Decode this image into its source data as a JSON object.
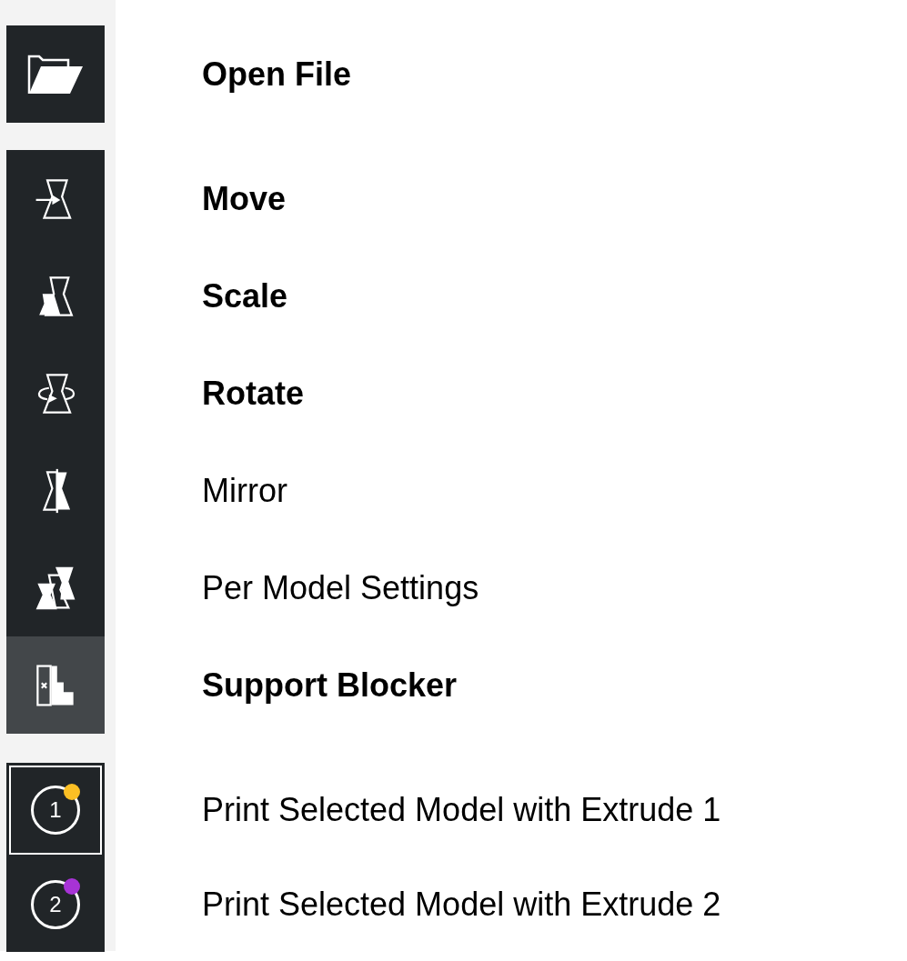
{
  "open_file": {
    "label": "Open File",
    "emphasized": true
  },
  "tools": [
    {
      "kind": "move",
      "label": "Move",
      "emphasized": true,
      "selected": false
    },
    {
      "kind": "scale",
      "label": "Scale",
      "emphasized": true,
      "selected": false
    },
    {
      "kind": "rotate",
      "label": "Rotate",
      "emphasized": true,
      "selected": false
    },
    {
      "kind": "mirror",
      "label": "Mirror",
      "emphasized": false,
      "selected": false
    },
    {
      "kind": "per_model",
      "label": "Per Model Settings",
      "emphasized": false,
      "selected": false
    },
    {
      "kind": "support_blocker",
      "label": "Support Blocker",
      "emphasized": true,
      "selected": true
    }
  ],
  "extruders": [
    {
      "number": "1",
      "color": "#fbbf24",
      "label": "Print Selected Model with Extrude 1",
      "emphasized": false,
      "selected": true
    },
    {
      "number": "2",
      "color": "#a733d6",
      "label": "Print Selected Model with Extrude 2",
      "emphasized": false,
      "selected": false
    }
  ]
}
